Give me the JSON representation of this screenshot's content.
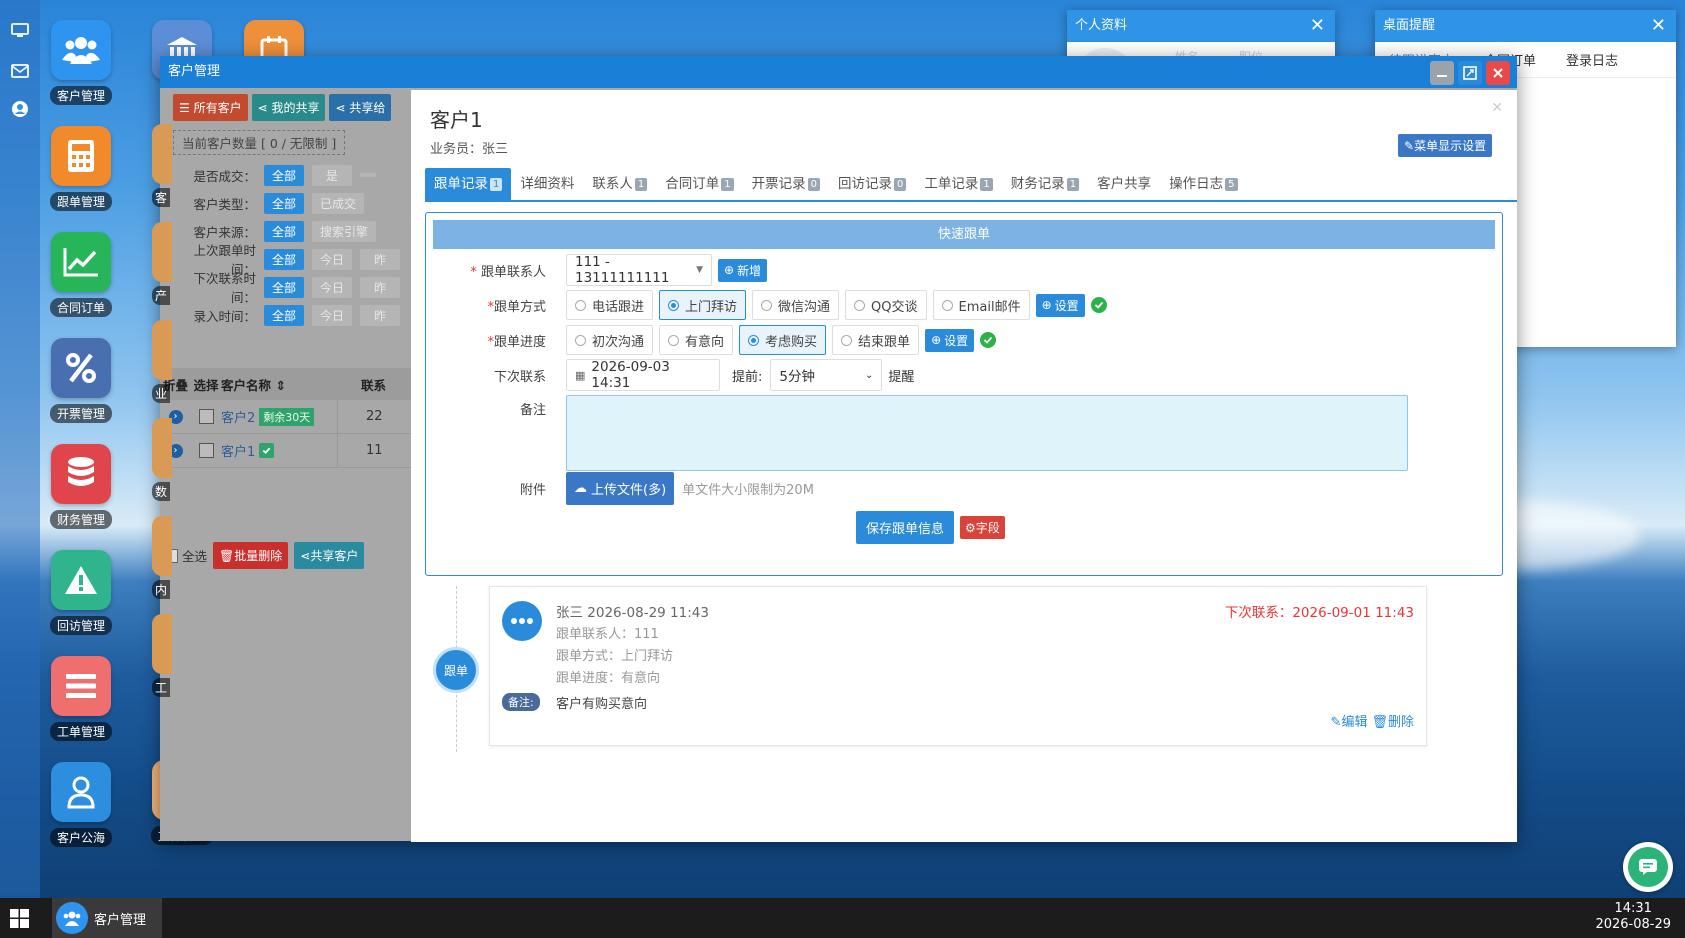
{
  "desktop": {
    "icons": [
      {
        "label": "客户管理",
        "color": "#2d95f0",
        "icon": "users-icon"
      },
      {
        "label": "跟单管理",
        "color": "#f08a2b",
        "icon": "calculator-icon"
      },
      {
        "label": "合同订单",
        "color": "#27b55a",
        "icon": "chart-line-icon"
      },
      {
        "label": "开票管理",
        "color": "#4a6fb0",
        "icon": "percent-icon"
      },
      {
        "label": "财务管理",
        "color": "#e0454b",
        "icon": "database-icon"
      },
      {
        "label": "回访管理",
        "color": "#2fb48e",
        "icon": "warning-icon"
      },
      {
        "label": "工单管理",
        "color": "#ef6f6f",
        "icon": "list-icon"
      },
      {
        "label": "客户公海",
        "color": "#2d8ee0",
        "icon": "user-icon"
      }
    ],
    "icons2": [
      {
        "label": "",
        "color": "#5b8ed6",
        "icon": "bank-icon"
      },
      {
        "label": "",
        "color": "#ef8f3a",
        "icon": "calendar-icon"
      }
    ],
    "col2_partial": [
      "客",
      "产",
      "业",
      "数",
      "内",
      "工"
    ],
    "col2_bottom": "文件管理"
  },
  "profile_window": {
    "title": "个人资料",
    "faded": [
      "姓名",
      "职位"
    ]
  },
  "reminder_window": {
    "title": "桌面提醒",
    "tabs": [
      "待跟进客户",
      "合同订单",
      "登录日志"
    ]
  },
  "customer_window": {
    "title": "客户管理",
    "toolbar": [
      "所有客户",
      "我的共享",
      "共享给"
    ],
    "count_text": "当前客户数量 [ 0 / 无限制 ]",
    "filters": [
      {
        "label": "是否成交：",
        "opts": [
          "全部",
          "是",
          ""
        ]
      },
      {
        "label": "客户类型：",
        "opts": [
          "全部",
          "已成交"
        ]
      },
      {
        "label": "客户来源：",
        "opts": [
          "全部",
          "搜索引擎"
        ]
      },
      {
        "label": "上次跟单时间：",
        "opts": [
          "全部",
          "今日",
          "昨"
        ]
      },
      {
        "label": "下次联系时间：",
        "opts": [
          "全部",
          "今日",
          "昨"
        ]
      },
      {
        "label": "录入时间：",
        "opts": [
          "全部",
          "今日",
          "昨"
        ]
      }
    ],
    "table_headers": [
      "折叠",
      "选择",
      "客户名称",
      "联系"
    ],
    "rows": [
      {
        "name": "客户2",
        "tag": "剩余30天",
        "num": "22"
      },
      {
        "name": "客户1",
        "tag": "",
        "num": "11"
      }
    ],
    "footer": {
      "select_all": "全选",
      "batch_delete": "批量删除",
      "share": "共享客户"
    }
  },
  "dialog": {
    "title": "客户1",
    "salesman": "业务员：张三",
    "menu_setting": "菜单显示设置",
    "tabs": [
      {
        "label": "跟单记录",
        "badge": "1"
      },
      {
        "label": "详细资料",
        "badge": ""
      },
      {
        "label": "联系人",
        "badge": "1"
      },
      {
        "label": "合同订单",
        "badge": "1"
      },
      {
        "label": "开票记录",
        "badge": "0"
      },
      {
        "label": "回访记录",
        "badge": "0"
      },
      {
        "label": "工单记录",
        "badge": "1"
      },
      {
        "label": "财务记录",
        "badge": "1"
      },
      {
        "label": "客户共享",
        "badge": ""
      },
      {
        "label": "操作日志",
        "badge": "5"
      }
    ],
    "form": {
      "header": "快速跟单",
      "contact_label": "跟单联系人",
      "contact_value": "111 - 13111111111",
      "add_btn": "新增",
      "method_label": "跟单方式",
      "methods": [
        "电话跟进",
        "上门拜访",
        "微信沟通",
        "QQ交谈",
        "Email邮件"
      ],
      "method_selected": 1,
      "progress_label": "跟单进度",
      "progresses": [
        "初次沟通",
        "有意向",
        "考虑购买",
        "结束跟单"
      ],
      "progress_selected": 2,
      "set_btn": "设置",
      "next_label": "下次联系",
      "next_value": "2026-09-03 14:31",
      "advance_label": "提前:",
      "advance_value": "5分钟",
      "remind": "提醒",
      "note_label": "备注",
      "attach_label": "附件",
      "upload_btn": "上传文件(多)",
      "upload_hint": "单文件大小限制为20M",
      "save_btn": "保存跟单信息",
      "field_btn": "字段"
    },
    "record": {
      "node": "跟单",
      "author_time": "张三 2026-08-29 11:43",
      "next_contact": "下次联系：2026-09-01 11:43",
      "contact": "跟单联系人：111",
      "method": "跟单方式：上门拜访",
      "progress": "跟单进度：有意向",
      "note_tag": "备注:",
      "note": "客户有购买意向",
      "edit": "编辑",
      "delete": "删除"
    }
  },
  "taskbar": {
    "app": "客户管理",
    "time": "14:31",
    "date": "2026-08-29"
  }
}
